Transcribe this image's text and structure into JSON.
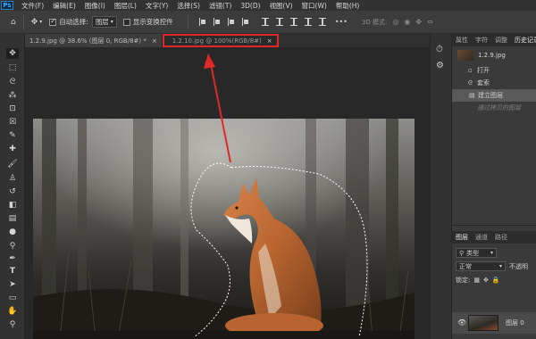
{
  "menubar": {
    "logo": "Ps",
    "items": [
      "文件(F)",
      "编辑(E)",
      "图像(I)",
      "图层(L)",
      "文字(Y)",
      "选择(S)",
      "滤镜(T)",
      "3D(D)",
      "视图(V)",
      "窗口(W)",
      "帮助(H)"
    ]
  },
  "options_bar": {
    "auto_select_label": "自动选择:",
    "auto_select_value": "图层",
    "show_transform_label": "显示变换控件",
    "mode_3d_label": "3D 模式:"
  },
  "tabs": [
    {
      "label": "1.2.9.jpg @ 38.6% (图层 0, RGB/8#) *",
      "close": "×"
    },
    {
      "label": "1.2.10.jpg @ 100%(RGB/8#)",
      "close": "×"
    }
  ],
  "history_panel": {
    "tabs": [
      "属性",
      "字符",
      "调整",
      "历史记录"
    ],
    "snapshot_label": "1.2.9.jpg",
    "steps": [
      "打开",
      "套索",
      "建立图层",
      "通过拷贝的图层"
    ]
  },
  "layers_panel": {
    "tabs": [
      "图层",
      "通道",
      "路径"
    ],
    "filter_label": "类型",
    "blend_mode": "正常",
    "opacity_label": "不透明",
    "lock_label": "锁定:",
    "layer_name": "图层 0"
  },
  "colors": {
    "annotation_red": "#e02828",
    "selection_marquee": "#ffffff",
    "panel_bg": "#3a3a3a",
    "canvas_bg": "#282828"
  },
  "icons": {
    "tools": [
      "move-tool-icon",
      "marquee-tool-icon",
      "lasso-tool-icon",
      "magic-wand-icon",
      "crop-tool-icon",
      "frame-tool-icon",
      "eyedropper-icon",
      "healing-brush-icon",
      "brush-tool-icon",
      "clone-stamp-icon",
      "history-brush-icon",
      "eraser-icon",
      "gradient-icon",
      "blur-icon",
      "dodge-icon",
      "pen-tool-icon",
      "type-tool-icon",
      "path-select-icon",
      "shape-tool-icon",
      "hand-tool-icon",
      "zoom-tool-icon"
    ]
  }
}
